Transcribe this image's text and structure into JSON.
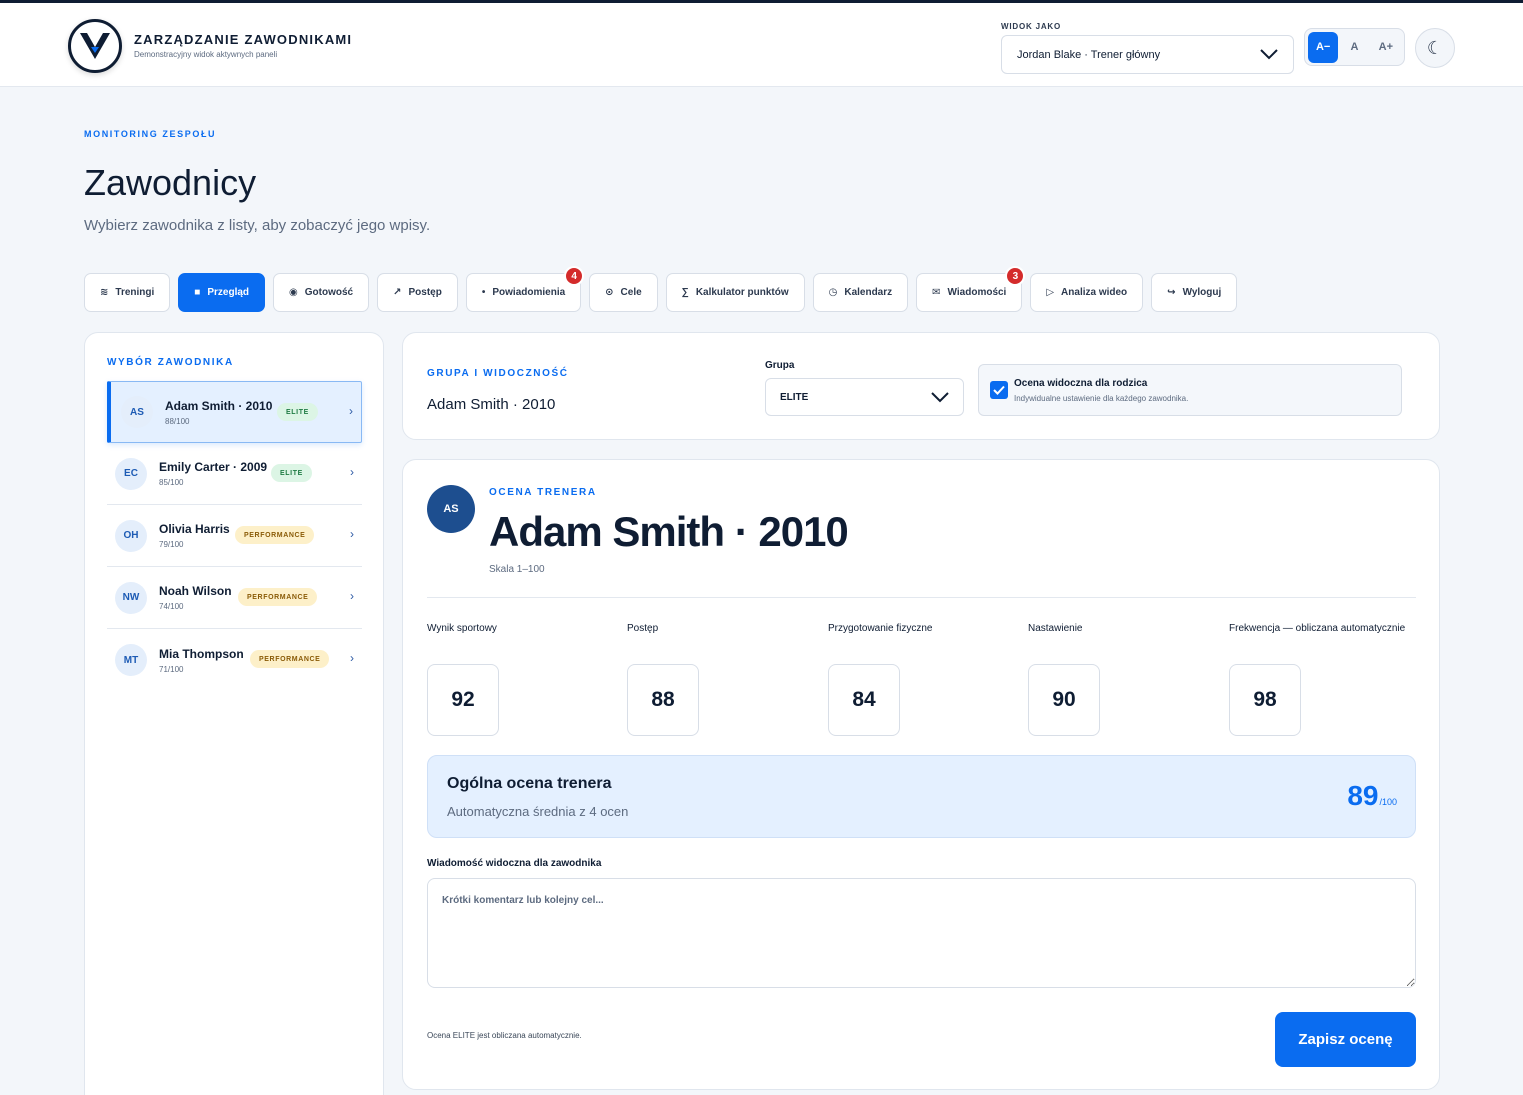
{
  "header": {
    "title": "ZARZĄDZANIE ZAWODNIKAMI",
    "subtitle": "Demonstracyjny widok aktywnych paneli",
    "view_as_label": "WIDOK JAKO",
    "view_as_value": "Jordan Blake · Trener główny",
    "font_sizes": [
      "A−",
      "A",
      "A+"
    ],
    "font_size_active": "A−",
    "theme_icon": "moon-icon"
  },
  "page": {
    "eyebrow": "MONITORING ZESPOŁU",
    "title": "Zawodnicy",
    "subtitle": "Wybierz zawodnika z listy, aby zobaczyć jego wpisy."
  },
  "tabs": [
    {
      "label": "Treningi",
      "icon": "wave-icon",
      "glyph": "≋"
    },
    {
      "label": "Przegląd",
      "icon": "square-icon",
      "glyph": "■",
      "active": true
    },
    {
      "label": "Gotowość",
      "icon": "circle-icon",
      "glyph": "◉"
    },
    {
      "label": "Postęp",
      "icon": "arrow-up-right-icon",
      "glyph": "↗"
    },
    {
      "label": "Powiadomienia",
      "icon": "dot-icon",
      "glyph": "•",
      "badge": "4"
    },
    {
      "label": "Cele",
      "icon": "target-icon",
      "glyph": "⊙"
    },
    {
      "label": "Kalkulator punktów",
      "icon": "sigma-icon",
      "glyph": "∑"
    },
    {
      "label": "Kalendarz",
      "icon": "clock-icon",
      "glyph": "◷"
    },
    {
      "label": "Wiadomości",
      "icon": "mail-icon",
      "glyph": "✉",
      "badge": "3"
    },
    {
      "label": "Analiza wideo",
      "icon": "play-icon",
      "glyph": "▷"
    },
    {
      "label": "Wyloguj",
      "icon": "logout-icon",
      "glyph": "↪"
    }
  ],
  "sidebar": {
    "title": "WYBÓR ZAWODNIKA",
    "players": [
      {
        "initials": "AS",
        "name": "Adam Smith · 2010",
        "score": "88/100",
        "group": "ELITE",
        "selected": true
      },
      {
        "initials": "EC",
        "name": "Emily Carter · 2009",
        "score": "85/100",
        "group": "ELITE"
      },
      {
        "initials": "OH",
        "name": "Olivia Harris",
        "score": "79/100",
        "group": "PERFORMANCE"
      },
      {
        "initials": "NW",
        "name": "Noah Wilson",
        "score": "74/100",
        "group": "PERFORMANCE"
      },
      {
        "initials": "MT",
        "name": "Mia Thompson",
        "score": "71/100",
        "group": "PERFORMANCE"
      }
    ]
  },
  "group_card": {
    "eyebrow": "GRUPA I WIDOCZNOŚĆ",
    "player": "Adam Smith · 2010",
    "group_label": "Grupa",
    "group_value": "ELITE",
    "visibility_title": "Ocena widoczna dla rodzica",
    "visibility_sub": "Indywidualne ustawienie dla każdego zawodnika.",
    "visibility_checked": true
  },
  "evaluation": {
    "initials": "AS",
    "eyebrow": "OCENA TRENERA",
    "player": "Adam Smith · 2010",
    "scale": "Skala 1–100",
    "metrics": [
      {
        "label": "Wynik sportowy",
        "value": "92"
      },
      {
        "label": "Postęp",
        "value": "88"
      },
      {
        "label": "Przygotowanie fizyczne",
        "value": "84"
      },
      {
        "label": "Nastawienie",
        "value": "90"
      },
      {
        "label": "Frekwencja — obliczana automatycznie",
        "value": "98"
      }
    ],
    "overall_title": "Ogólna ocena trenera",
    "overall_sub": "Automatyczna średnia z 4 ocen",
    "overall_value": "89",
    "overall_max": "/100",
    "message_label": "Wiadomość widoczna dla zawodnika",
    "message_placeholder": "Krótki komentarz lub kolejny cel...",
    "message_value": "",
    "note": "Ocena ELITE jest obliczana automatycznie.",
    "save_label": "Zapisz ocenę"
  },
  "colors": {
    "accent": "#0a6cf0",
    "badge": "#d42b2b",
    "elite_bg": "#dcf5e5",
    "performance_bg": "#fdf0c9",
    "avatar_dark": "#1d4e8f"
  }
}
